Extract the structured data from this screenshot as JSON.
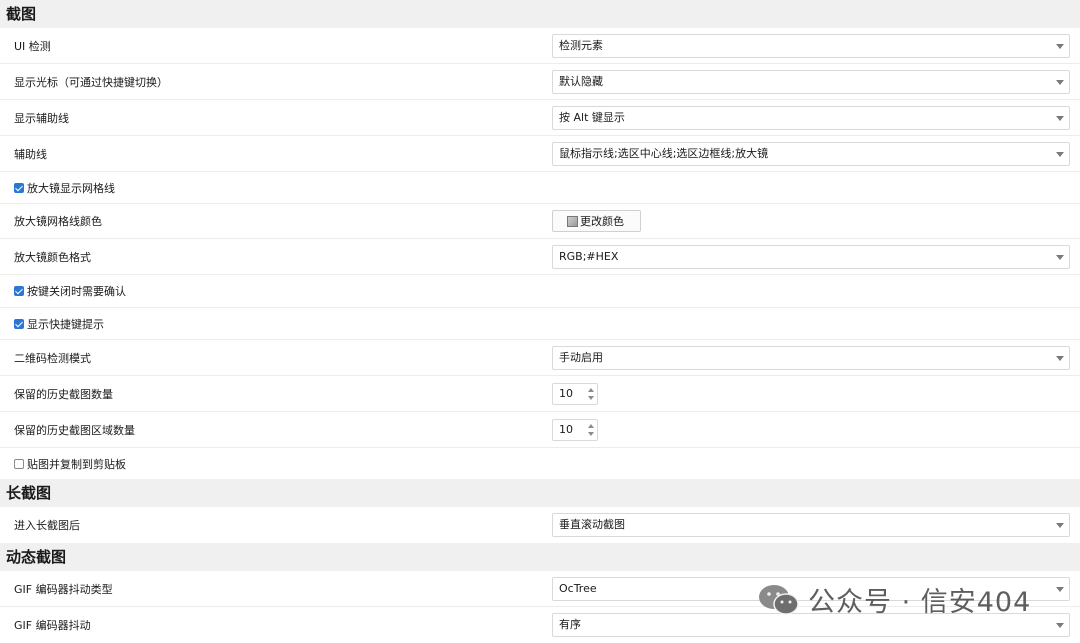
{
  "sections": {
    "screenshot": {
      "title": "截图",
      "ui_detect": {
        "label": "UI 检测",
        "value": "检测元素"
      },
      "show_cursor": {
        "label": "显示光标（可通过快捷键切换）",
        "value": "默认隐藏"
      },
      "show_guides": {
        "label": "显示辅助线",
        "value": "按 Alt 键显示"
      },
      "guides": {
        "label": "辅助线",
        "value": "鼠标指示线;选区中心线;选区边框线;放大镜"
      },
      "magnifier_grid": {
        "label": "放大镜显示网格线",
        "checked": true
      },
      "magnifier_grid_color": {
        "label": "放大镜网格线颜色",
        "button": "更改颜色"
      },
      "magnifier_color_format": {
        "label": "放大镜颜色格式",
        "value": "RGB;#HEX"
      },
      "confirm_close": {
        "label": "按键关闭时需要确认",
        "checked": true
      },
      "show_hotkey_hints": {
        "label": "显示快捷键提示",
        "checked": true
      },
      "qr_mode": {
        "label": "二维码检测模式",
        "value": "手动启用"
      },
      "history_count": {
        "label": "保留的历史截图数量",
        "value": "10"
      },
      "history_region_count": {
        "label": "保留的历史截图区域数量",
        "value": "10"
      },
      "pin_copy": {
        "label": "贴图并复制到剪贴板",
        "checked": false
      }
    },
    "long_screenshot": {
      "title": "长截图",
      "after_enter": {
        "label": "进入长截图后",
        "value": "垂直滚动截图"
      }
    },
    "gif": {
      "title": "动态截图",
      "dither_type": {
        "label": "GIF 编码器抖动类型",
        "value": "OcTree"
      },
      "dither": {
        "label": "GIF 编码器抖动",
        "value": "有序"
      }
    }
  },
  "watermark": {
    "text": "公众号 · 信安404",
    "icon": "wechat-icon"
  },
  "colors": {
    "accent": "#2a78d4",
    "background": "#f0f0f0",
    "panel": "#ffffff"
  }
}
